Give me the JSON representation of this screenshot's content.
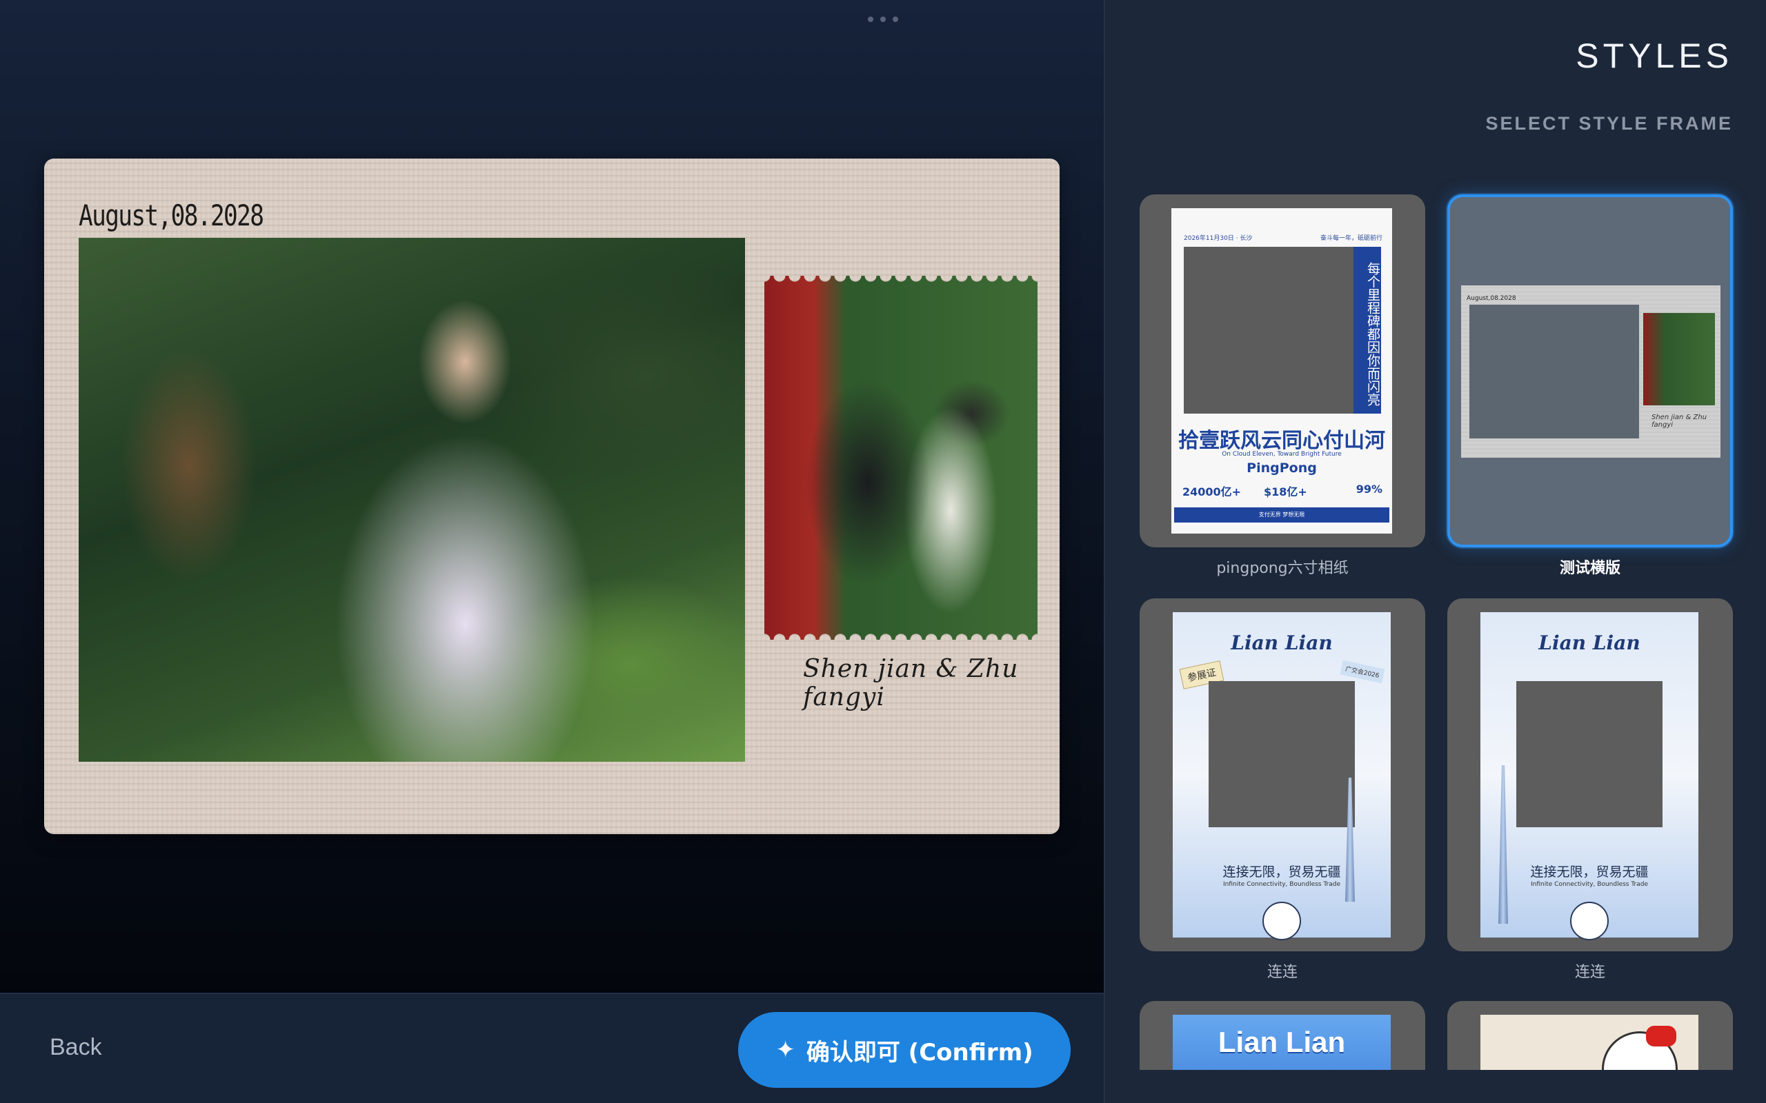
{
  "editor": {
    "card": {
      "date": "August,08.2028",
      "signature": "Shen jian & Zhu fangyi"
    }
  },
  "footer": {
    "back_label": "Back",
    "confirm_label": "确认即可 (Confirm)",
    "confirm_icon": "sparkle-icon"
  },
  "styles_panel": {
    "title": "STYLES",
    "subtitle": "SELECT STYLE FRAME",
    "items": [
      {
        "label": "pingpong六寸相纸",
        "selected": false,
        "thumb": {
          "header_left": "2026年11月30日 · 长沙",
          "header_right": "奋斗每一年，砥砺前行",
          "vertical_text": "每个里程碑都因你而闪亮",
          "slogan": "拾壹跃风云同心付山河",
          "sub": "On Cloud Eleven, Toward Bright Future",
          "brand": "PingPong",
          "stat1": "24000亿+",
          "stat2": "$18亿+",
          "stat3": "99%",
          "footer": "支付无界 梦想无限"
        }
      },
      {
        "label": "测试横版",
        "selected": true,
        "thumb": {
          "date": "August,08.2028",
          "signature": "Shen jian & Zhu fangyi"
        }
      },
      {
        "label": "连连",
        "selected": false,
        "thumb": {
          "title": "Lian Lian",
          "badge": "参展证",
          "tag": "广交会2026",
          "slogan": "连接无限，贸易无疆",
          "sub": "Infinite Connectivity, Boundless Trade"
        }
      },
      {
        "label": "连连",
        "selected": false,
        "thumb": {
          "title": "Lian Lian",
          "slogan": "连接无限，贸易无疆",
          "sub": "Infinite Connectivity, Boundless Trade"
        }
      },
      {
        "label": "",
        "thumb": {
          "title": "Lian Lian"
        }
      },
      {
        "label": "",
        "thumb": {}
      }
    ]
  },
  "colors": {
    "accent": "#1f84df",
    "selected_border": "#2e93f2",
    "panel_bg": "#1c2739"
  }
}
